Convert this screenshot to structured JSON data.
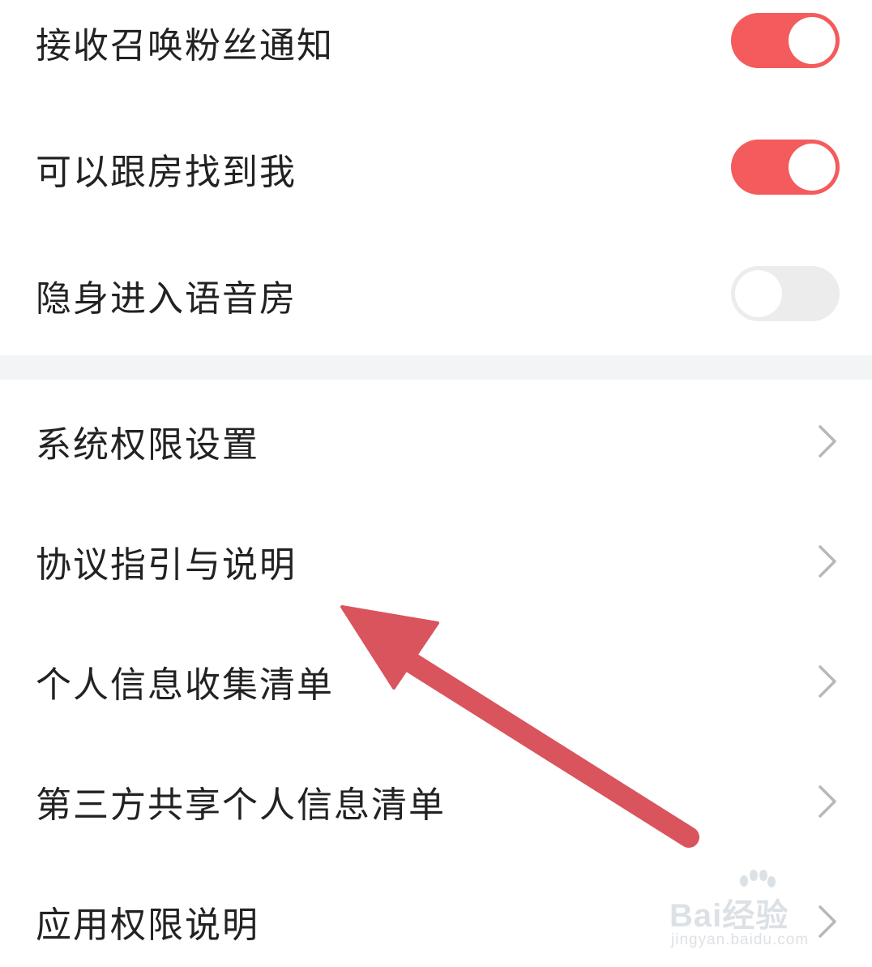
{
  "settings": {
    "toggles": [
      {
        "label": "接收召唤粉丝通知",
        "state": "on"
      },
      {
        "label": "可以跟房找到我",
        "state": "on"
      },
      {
        "label": "隐身进入语音房",
        "state": "off"
      }
    ],
    "links": [
      {
        "label": "系统权限设置",
        "icon": "chevron-right-icon"
      },
      {
        "label": "协议指引与说明",
        "icon": "chevron-right-icon"
      },
      {
        "label": "个人信息收集清单",
        "icon": "chevron-right-icon"
      },
      {
        "label": "第三方共享个人信息清单",
        "icon": "chevron-right-icon"
      },
      {
        "label": "应用权限说明",
        "icon": "chevron-right-icon"
      }
    ]
  },
  "colors": {
    "toggle_on": "#f45b5c",
    "toggle_off": "#ececec",
    "arrow": "#d9545c",
    "divider": "#f3f4f6",
    "chevron": "#b8b8b8"
  },
  "watermark": {
    "main": "Bai经验",
    "du": "du",
    "sub": "jingyan.baidu.com"
  }
}
